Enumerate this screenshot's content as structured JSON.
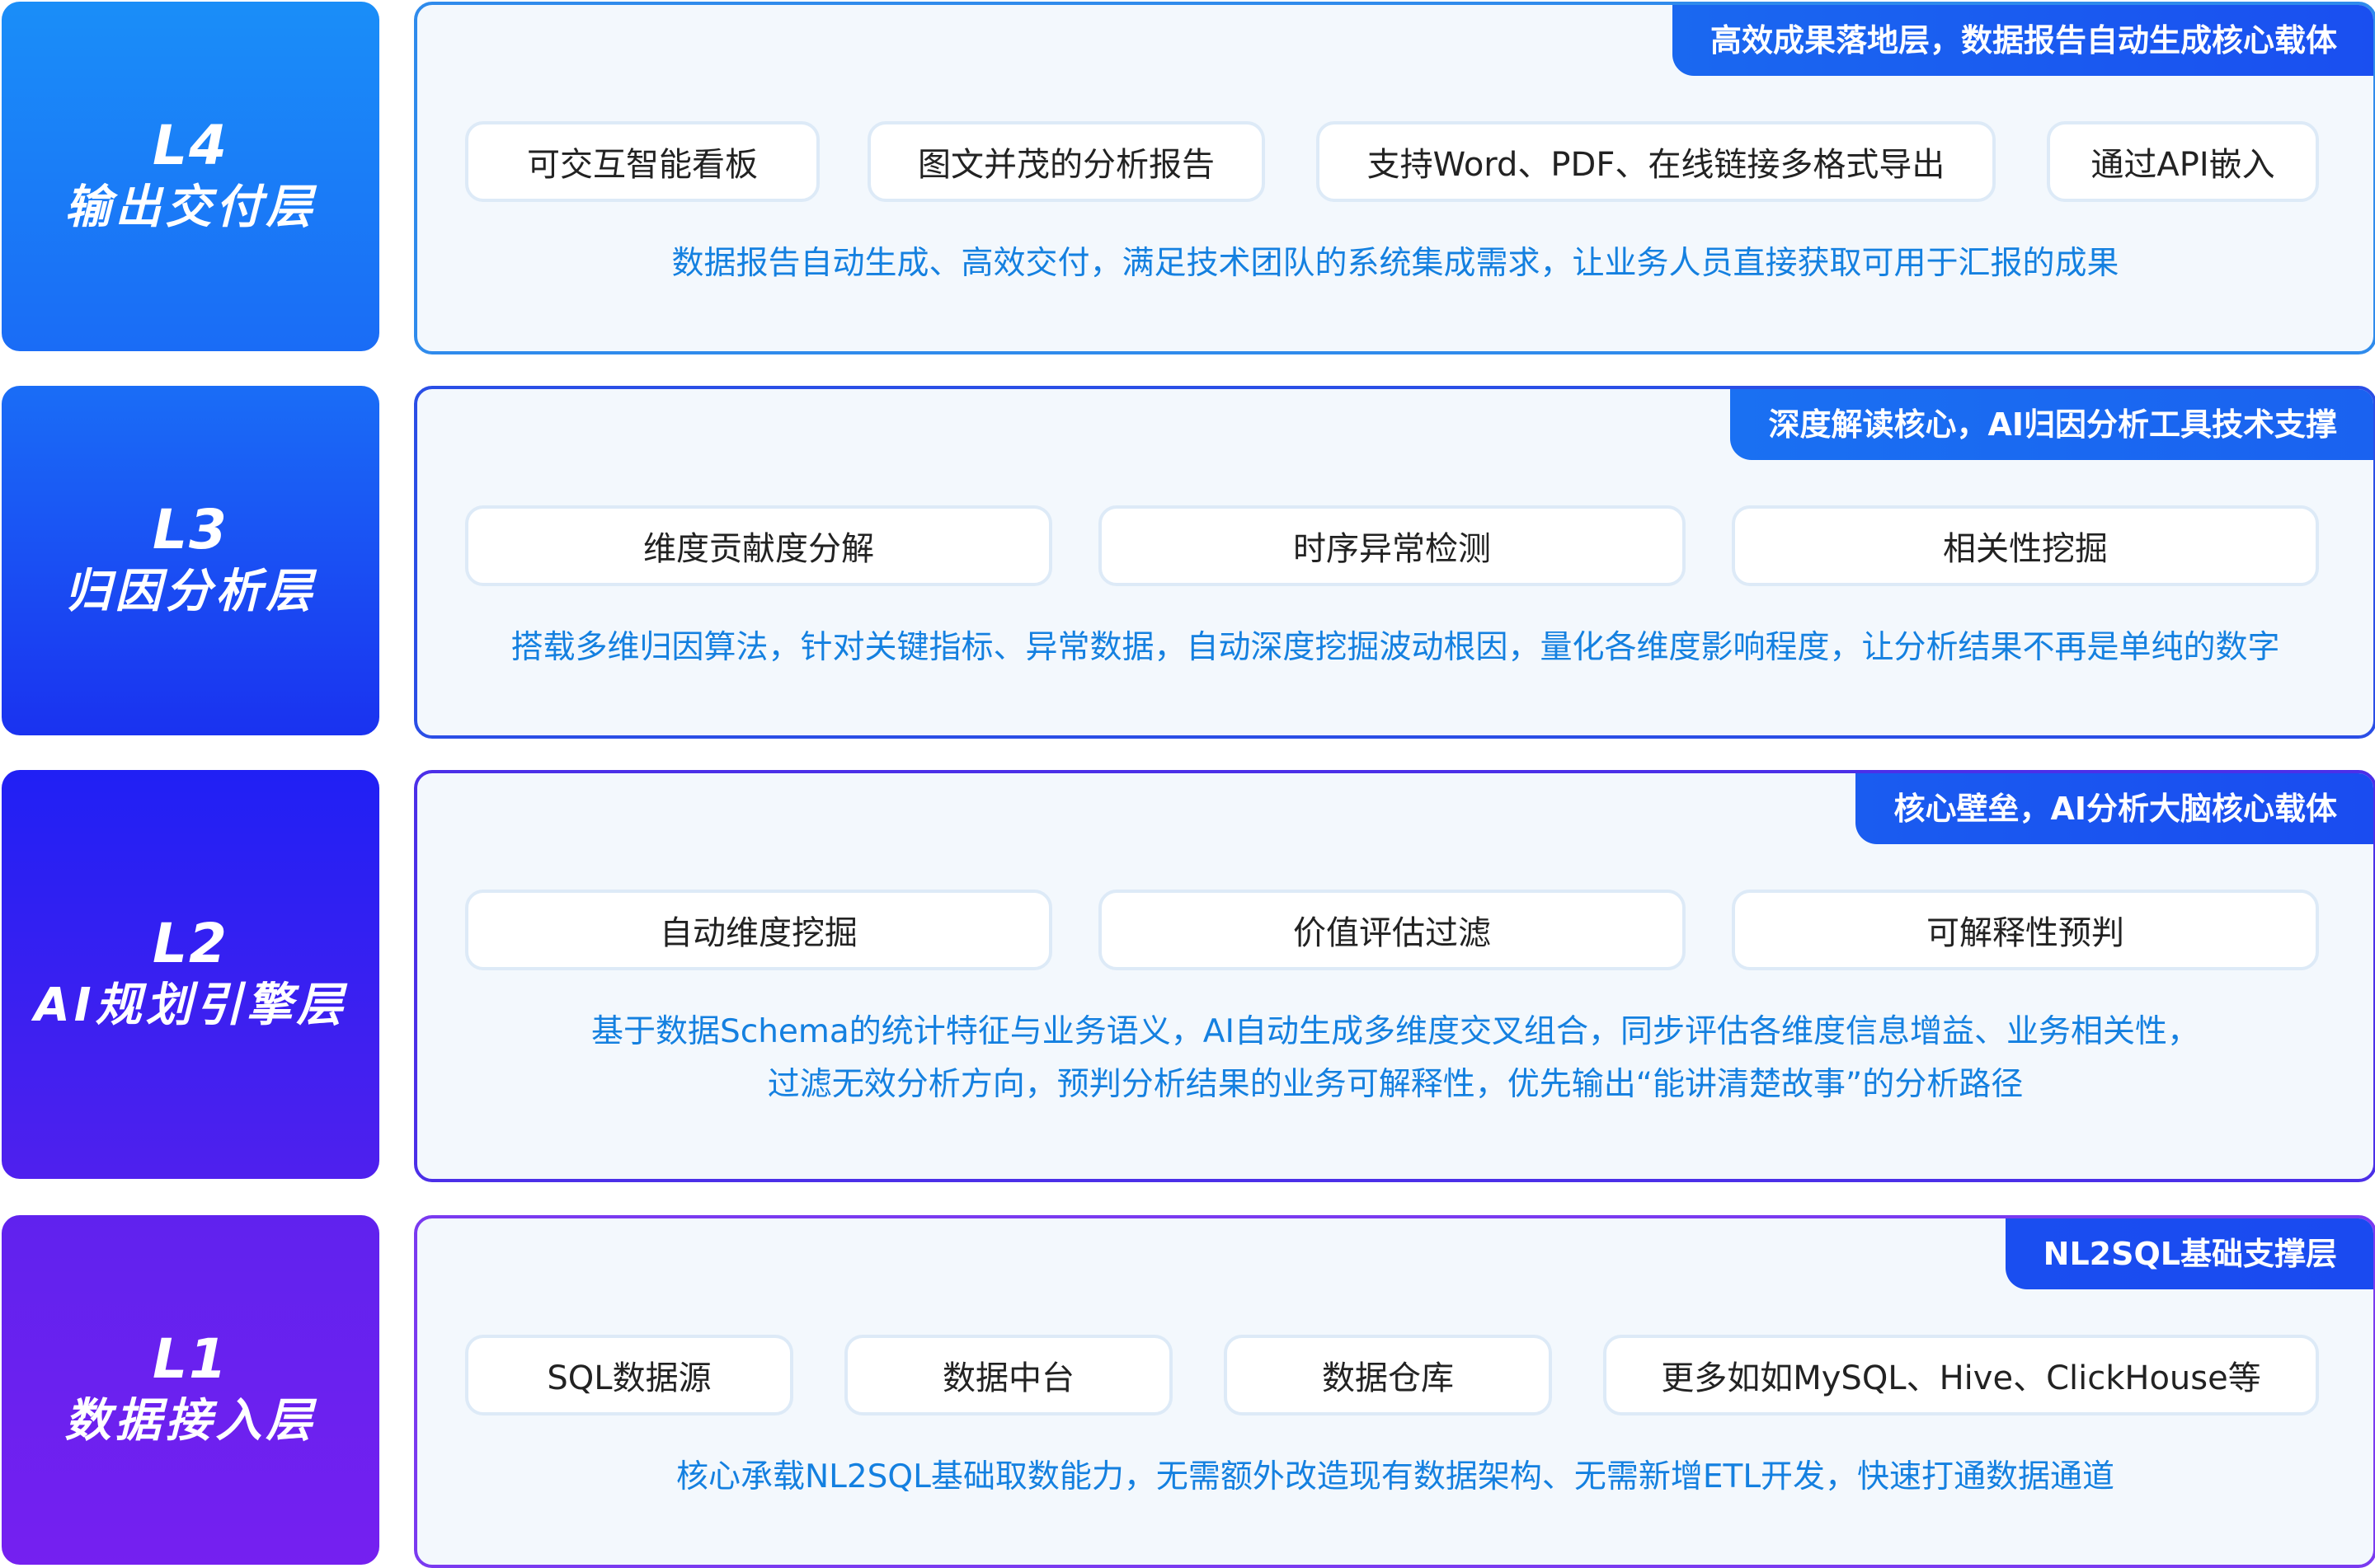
{
  "layers": [
    {
      "code": "L4",
      "name": "输出交付层",
      "tag": "高效成果落地层，数据报告自动生成核心载体",
      "items": [
        "可交互智能看板",
        "图文并茂的分析报告",
        "支持Word、PDF、在线链接多格式导出",
        "通过API嵌入"
      ],
      "description": [
        "数据报告自动生成、高效交付，满足技术团队的系统集成需求，让业务人员直接获取可用于汇报的成果"
      ]
    },
    {
      "code": "L3",
      "name": "归因分析层",
      "tag": "深度解读核心，AI归因分析工具技术支撑",
      "items": [
        "维度贡献度分解",
        "时序异常检测",
        "相关性挖掘"
      ],
      "description": [
        "搭载多维归因算法，针对关键指标、异常数据，自动深度挖掘波动根因，量化各维度影响程度，让分析结果不再是单纯的数字"
      ]
    },
    {
      "code": "L2",
      "name": "AI规划引擎层",
      "tag": "核心壁垒，AI分析大脑核心载体",
      "items": [
        "自动维度挖掘",
        "价值评估过滤",
        "可解释性预判"
      ],
      "description": [
        "基于数据Schema的统计特征与业务语义，AI自动生成多维度交叉组合，同步评估各维度信息增益、业务相关性，",
        "过滤无效分析方向，预判分析结果的业务可解释性，优先输出“能讲清楚故事”的分析路径"
      ]
    },
    {
      "code": "L1",
      "name": "数据接入层",
      "tag": "NL2SQL基础支撑层",
      "items": [
        "SQL数据源",
        "数据中台",
        "数据仓库",
        "更多如如MySQL、Hive、ClickHouse等"
      ],
      "description": [
        "核心承载NL2SQL基础取数能力，无需额外改造现有数据架构、无需新增ETL开发，快速打通数据通道"
      ]
    }
  ],
  "colors": {
    "label_gradients": [
      [
        "#1a8ef8",
        "#1a6cf6"
      ],
      [
        "#1a6df6",
        "#1a32f0"
      ],
      [
        "#2020f4",
        "#4f20ee"
      ],
      [
        "#6022ee",
        "#7520f0"
      ]
    ],
    "panel_borders": [
      "#2f8bec",
      "#2a4ee6",
      "#4b2fe8",
      "#7a3af0"
    ],
    "tag_gradients": [
      [
        "#1a68f0",
        "#1a4ff0"
      ],
      [
        "#1a70f2",
        "#1a62f0"
      ],
      [
        "#1a5cf0",
        "#1a4cf0"
      ],
      [
        "#1a4ef0",
        "#1a4af0"
      ]
    ],
    "item_text": "#222222",
    "description_text": "#1480e0"
  }
}
